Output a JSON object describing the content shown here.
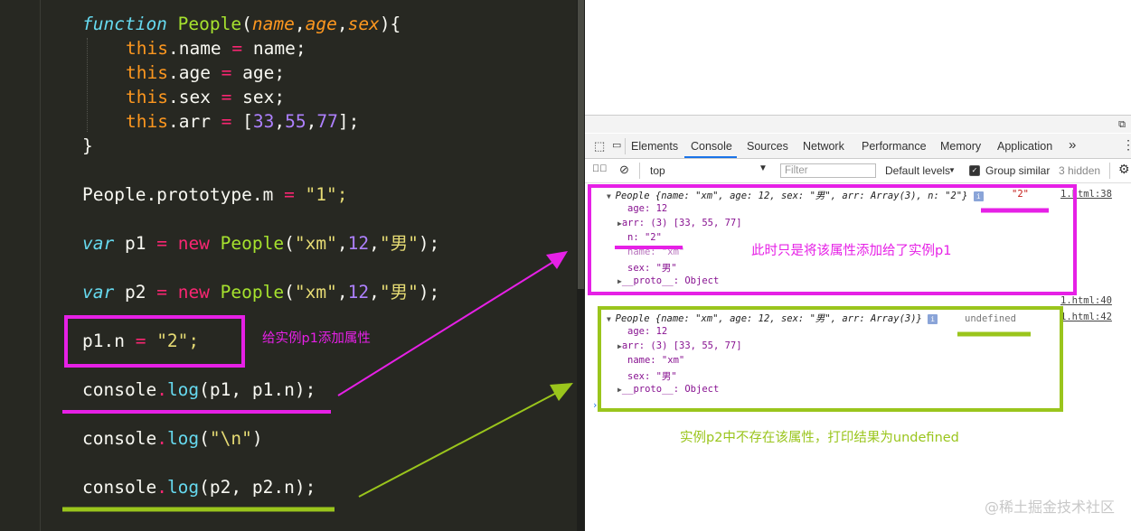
{
  "editor": {
    "line1": {
      "kw": "function",
      "name": "People",
      "open": "(",
      "p1": "name",
      "c1": ",",
      "p2": "age",
      "c2": ",",
      "p3": "sex",
      "close": "){"
    },
    "line2": {
      "this": "this",
      "rest": ".name ",
      "op": "=",
      "val": " name;"
    },
    "line3": {
      "this": "this",
      "rest": ".age ",
      "op": "=",
      "val": " age;"
    },
    "line4": {
      "this": "this",
      "rest": ".sex ",
      "op": "=",
      "val": " sex;"
    },
    "line5": {
      "this": "this",
      "rest": ".arr ",
      "op": "=",
      "a": " [",
      "n1": "33",
      "c1": ",",
      "n2": "55",
      "c2": ",",
      "n3": "77",
      "b": "];"
    },
    "line6": {
      "text": "}"
    },
    "line7": {
      "text": "People.prototype.m ",
      "op": "=",
      "str": " \"1\";"
    },
    "line8": {
      "kw": "var",
      "v": " p1 ",
      "op": "=",
      "sp": " ",
      "new": "new",
      "fn": " People",
      "a": "(",
      "s1": "\"xm\"",
      "c1": ",",
      "num": "12",
      "c2": ",",
      "s2": "\"男\"",
      "b": ");"
    },
    "line9": {
      "kw": "var",
      "v": " p2 ",
      "op": "=",
      "sp": " ",
      "new": "new",
      "fn": " People",
      "a": "(",
      "s1": "\"xm\"",
      "c1": ",",
      "num": "12",
      "c2": ",",
      "s2": "\"男\"",
      "b": ");"
    },
    "line10": {
      "a": "p1.n ",
      "op": "=",
      "str": " \"2\";"
    },
    "line11": {
      "a": "console",
      "dot": ".",
      "fn": "log",
      "b": "(p1, p1.n);"
    },
    "line12": {
      "a": "console",
      "dot": ".",
      "fn": "log",
      "b": "(",
      "str": "\"\\n\"",
      "c": ")"
    },
    "line13": {
      "a": "console",
      "dot": ".",
      "fn": "log",
      "b": "(p2, p2.n);"
    }
  },
  "devtools": {
    "tabs": [
      "Elements",
      "Console",
      "Sources",
      "Network",
      "Performance",
      "Memory",
      "Application"
    ],
    "more_tabs": "»",
    "active_tab": "Console",
    "context": "top",
    "filter_placeholder": "Filter",
    "default_levels": "Default levels",
    "group_similar": "Group similar",
    "hidden_count": "3 hidden",
    "entries": {
      "p1_summary": "People {name: \"xm\", age: 12, sex: \"男\", arr: Array(3), n: \"2\"}",
      "p1_value": "\"2\"",
      "p1_source": "1.html:38",
      "p1_age": "age: 12",
      "p1_arr": "arr: (3) [33, 55, 77]",
      "p1_n": "n: \"2\"",
      "p1_name": "name: \"xm\"",
      "p1_sex": "sex: \"男\"",
      "p1_proto": "__proto__: Object",
      "newline_source": "1.html:40",
      "p2_summary": "People {name: \"xm\", age: 12, sex: \"男\", arr: Array(3)}",
      "p2_value": "undefined",
      "p2_source": "1.html:42",
      "p2_age": "age: 12",
      "p2_arr": "arr: (3) [33, 55, 77]",
      "p2_name": "name: \"xm\"",
      "p2_sex": "sex: \"男\"",
      "p2_proto": "__proto__: Object",
      "prompt": "›"
    }
  },
  "annotations": {
    "add_prop": "给实例p1添加属性",
    "only_p1": "此时只是将该属性添加给了实例p1",
    "p2_undefined": "实例p2中不存在该属性，打印结果为undefined"
  },
  "watermark": "@稀土掘金技术社区",
  "colors": {
    "magenta": "#e620e6",
    "green": "#9ac51c",
    "editor_bg": "#272822"
  }
}
